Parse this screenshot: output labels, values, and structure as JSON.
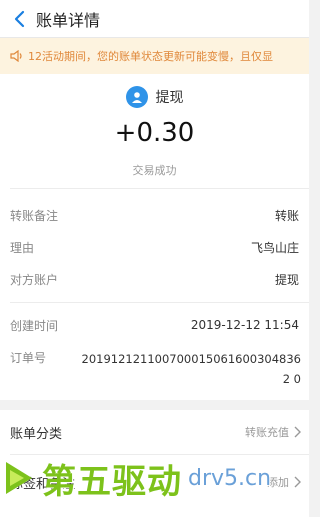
{
  "header": {
    "title": "账单详情"
  },
  "notice": {
    "text": "12活动期间，您的账单状态更新可能变慢，且仅显"
  },
  "summary": {
    "payee": "提现",
    "amount": "+0.30",
    "status": "交易成功"
  },
  "details": {
    "rows": [
      {
        "label": "转账备注",
        "value": "转账"
      },
      {
        "label": "理由",
        "value": "飞鸟山庄"
      },
      {
        "label": "对方账户",
        "value": "提现"
      },
      {
        "label": "创建时间",
        "value": "2019-12-12 11:54"
      }
    ],
    "order": {
      "label": "订单号",
      "value": "2019121211007000150616003048362 0"
    }
  },
  "category": {
    "rows": [
      {
        "label": "账单分类",
        "value": "转账充值"
      },
      {
        "label": "标签和备注",
        "value": "添加"
      }
    ]
  },
  "watermark": {
    "cn": "第五驱动",
    "en": "drv5.cn"
  },
  "colors": {
    "accent": "#2f93e8",
    "notice_bg": "#fdf3df",
    "notice_text": "#e0883a",
    "watermark_green": "#7dc21b"
  },
  "icons": {
    "back": "back-arrow-icon",
    "notice": "speaker-icon",
    "avatar": "user-icon",
    "chevron": "chevron-right-icon"
  }
}
